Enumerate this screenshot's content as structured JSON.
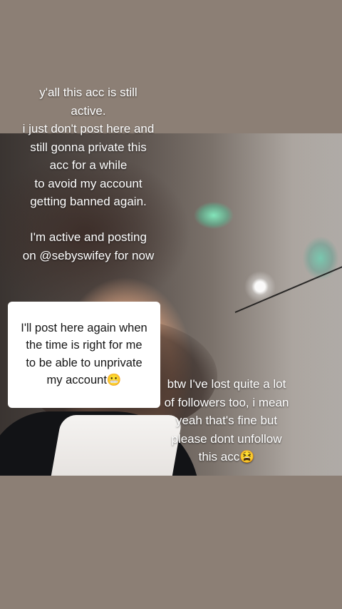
{
  "captions": {
    "main": "y'all this acc is still\nactive.\ni just don't post here and\nstill gonna private this\nacc for a while\nto avoid my account\ngetting banned again.",
    "active": "I'm active and posting\non @sebyswifey for now",
    "box_main": "I'll post here again when\nthe time is right for me\nto be able to unprivate",
    "box_end": "my account😬",
    "followers": "btw I've lost quite a lot\nof followers too, i mean\nyeah that's fine but\nplease dont unfollow\nthis acc😫"
  },
  "colors": {
    "background": "#8c7f75",
    "caption_text": "#ffffff",
    "box_background": "#ffffff",
    "box_text": "#151515"
  }
}
